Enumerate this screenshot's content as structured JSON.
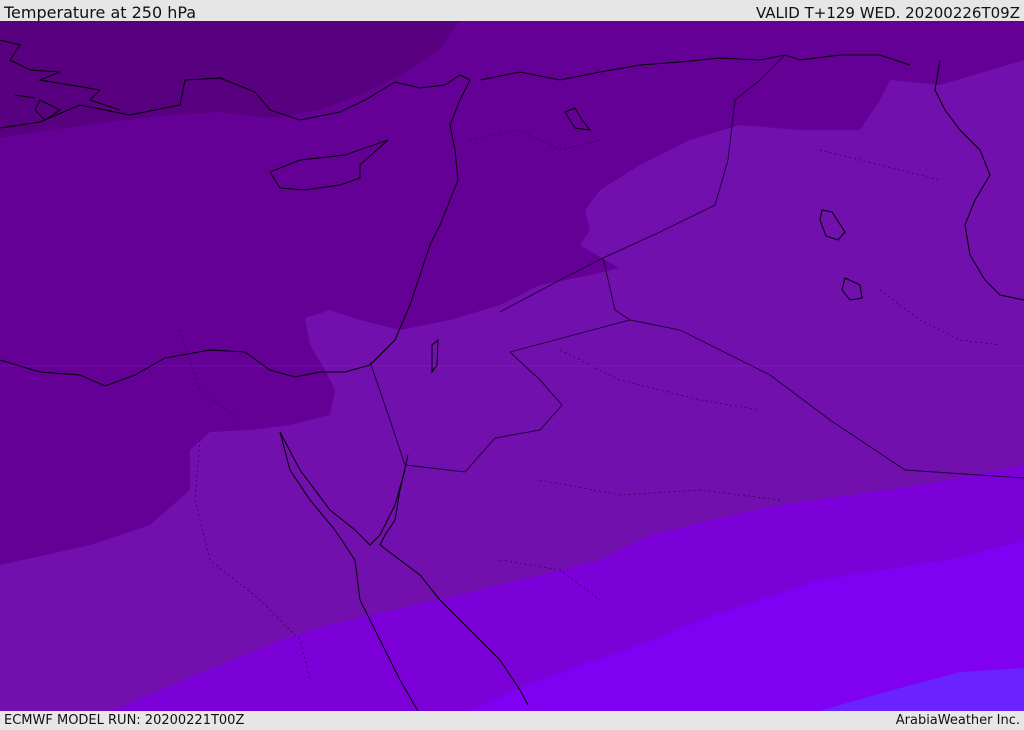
{
  "header": {
    "title": "Temperature at 250 hPa",
    "valid": "VALID T+129 WED. 20200226T09Z"
  },
  "footer": {
    "model_run": "ECMWF MODEL RUN: 20200221T00Z",
    "credit": "ArabiaWeather Inc."
  },
  "map": {
    "variable": "temperature",
    "level": "250 hPa",
    "colors": {
      "coldest_band": "#580080",
      "cold_band": "#640096",
      "mid_band": "#7210ae",
      "warm_band": "#7c00d8",
      "warmer_band": "#8000f4",
      "warmest_band": "#6a22ff",
      "coastline": "#000000",
      "border": "#1a0030"
    }
  }
}
